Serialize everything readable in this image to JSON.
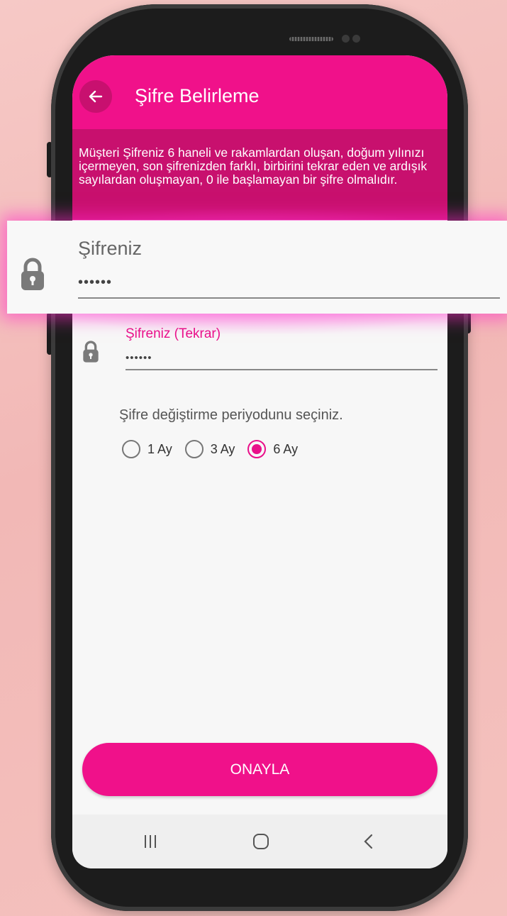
{
  "header": {
    "title": "Şifre Belirleme"
  },
  "info": {
    "text": "Müşteri Şifreniz 6 haneli ve rakamlardan oluşan, doğum yılınızı içermeyen, son şifrenizden farklı, birbirini tekrar eden ve ardışık sayılardan oluşmayan, 0 ile başlamayan bir şifre olmalıdır."
  },
  "form": {
    "password": {
      "label": "Şifreniz",
      "value": "••••••"
    },
    "password_repeat": {
      "label": "Şifreniz (Tekrar)",
      "value": "••••••"
    },
    "period_label": "Şifre değiştirme periyodunu seçiniz.",
    "period_options": [
      {
        "label": "1 Ay",
        "selected": false
      },
      {
        "label": "3 Ay",
        "selected": false
      },
      {
        "label": "6 Ay",
        "selected": true
      }
    ]
  },
  "actions": {
    "confirm_label": "ONAYLA"
  },
  "colors": {
    "accent": "#f0118a",
    "info_bg": "#c8106e"
  }
}
